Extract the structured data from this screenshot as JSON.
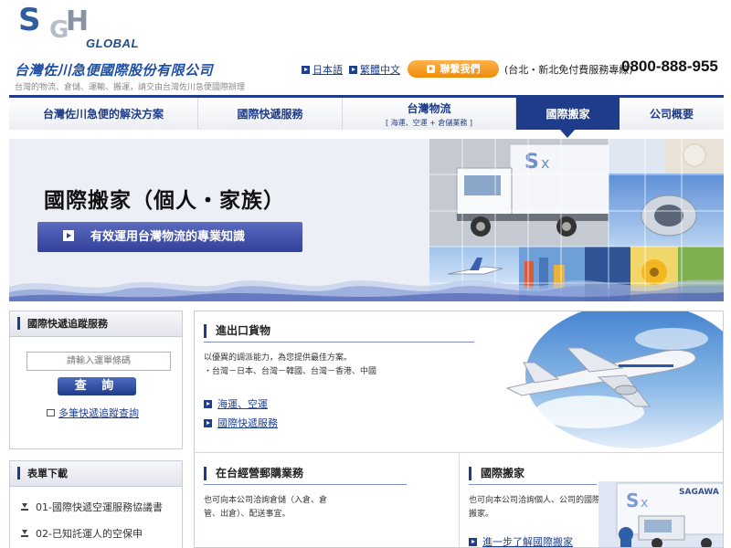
{
  "header": {
    "logo_text": "SGH",
    "logo_sub": "GLOBAL",
    "company_name": "台灣佐川急便國際股份有限公司",
    "tagline": "台灣的物流、倉儲、運輸、搬運，請交由台灣佐川急便國際辦理",
    "lang_jp": "日本語",
    "lang_tc": "繁體中文",
    "contact_button": "聯繫我們",
    "hotline_label": "(台北・新北免付費服務專線)",
    "hotline_number": "0800-888-955"
  },
  "nav": {
    "solutions": "台灣佐川急便的解決方案",
    "express": "國際快遞服務",
    "logistics": "台灣物流",
    "logistics_sub": "[ 海運、空運 + 倉儲業務 ]",
    "moving": "國際搬家",
    "about": "公司概要"
  },
  "banner": {
    "title": "國際搬家（個人・家族）",
    "cta": "有效運用台灣物流的專業知識"
  },
  "tracking": {
    "heading": "國際快遞追蹤服務",
    "placeholder": "請輸入運單條碼",
    "submit": "查 詢",
    "multi_link": "多筆快遞追蹤查詢"
  },
  "forms": {
    "heading": "表單下載",
    "items": [
      "01-國際快遞空運服務協議書",
      "02-已知託運人的空保申"
    ]
  },
  "import_export": {
    "title": "進出口貨物",
    "desc_line1": "以優異的調派能力，為您提供最佳方案。",
    "desc_line2": "・台灣－日本、台灣－韓國、台灣－香港、中國",
    "link_sea_air": "海運、空運",
    "link_express": "國際快遞服務"
  },
  "purchase": {
    "title": "在台經營郵購業務",
    "desc": "也可向本公司洽詢倉儲（入倉、倉管、出倉）、配送事宜。"
  },
  "moving": {
    "title": "國際搬家",
    "desc": "也可向本公司洽詢個人、公司的國際搬家。",
    "link_more": "進一步了解國際搬家",
    "truck_brand": "SAGAWA"
  },
  "colors": {
    "brand_navy": "#1f3c8a",
    "accent_orange": "#f08a0c",
    "link_blue": "#1e3f8f"
  }
}
